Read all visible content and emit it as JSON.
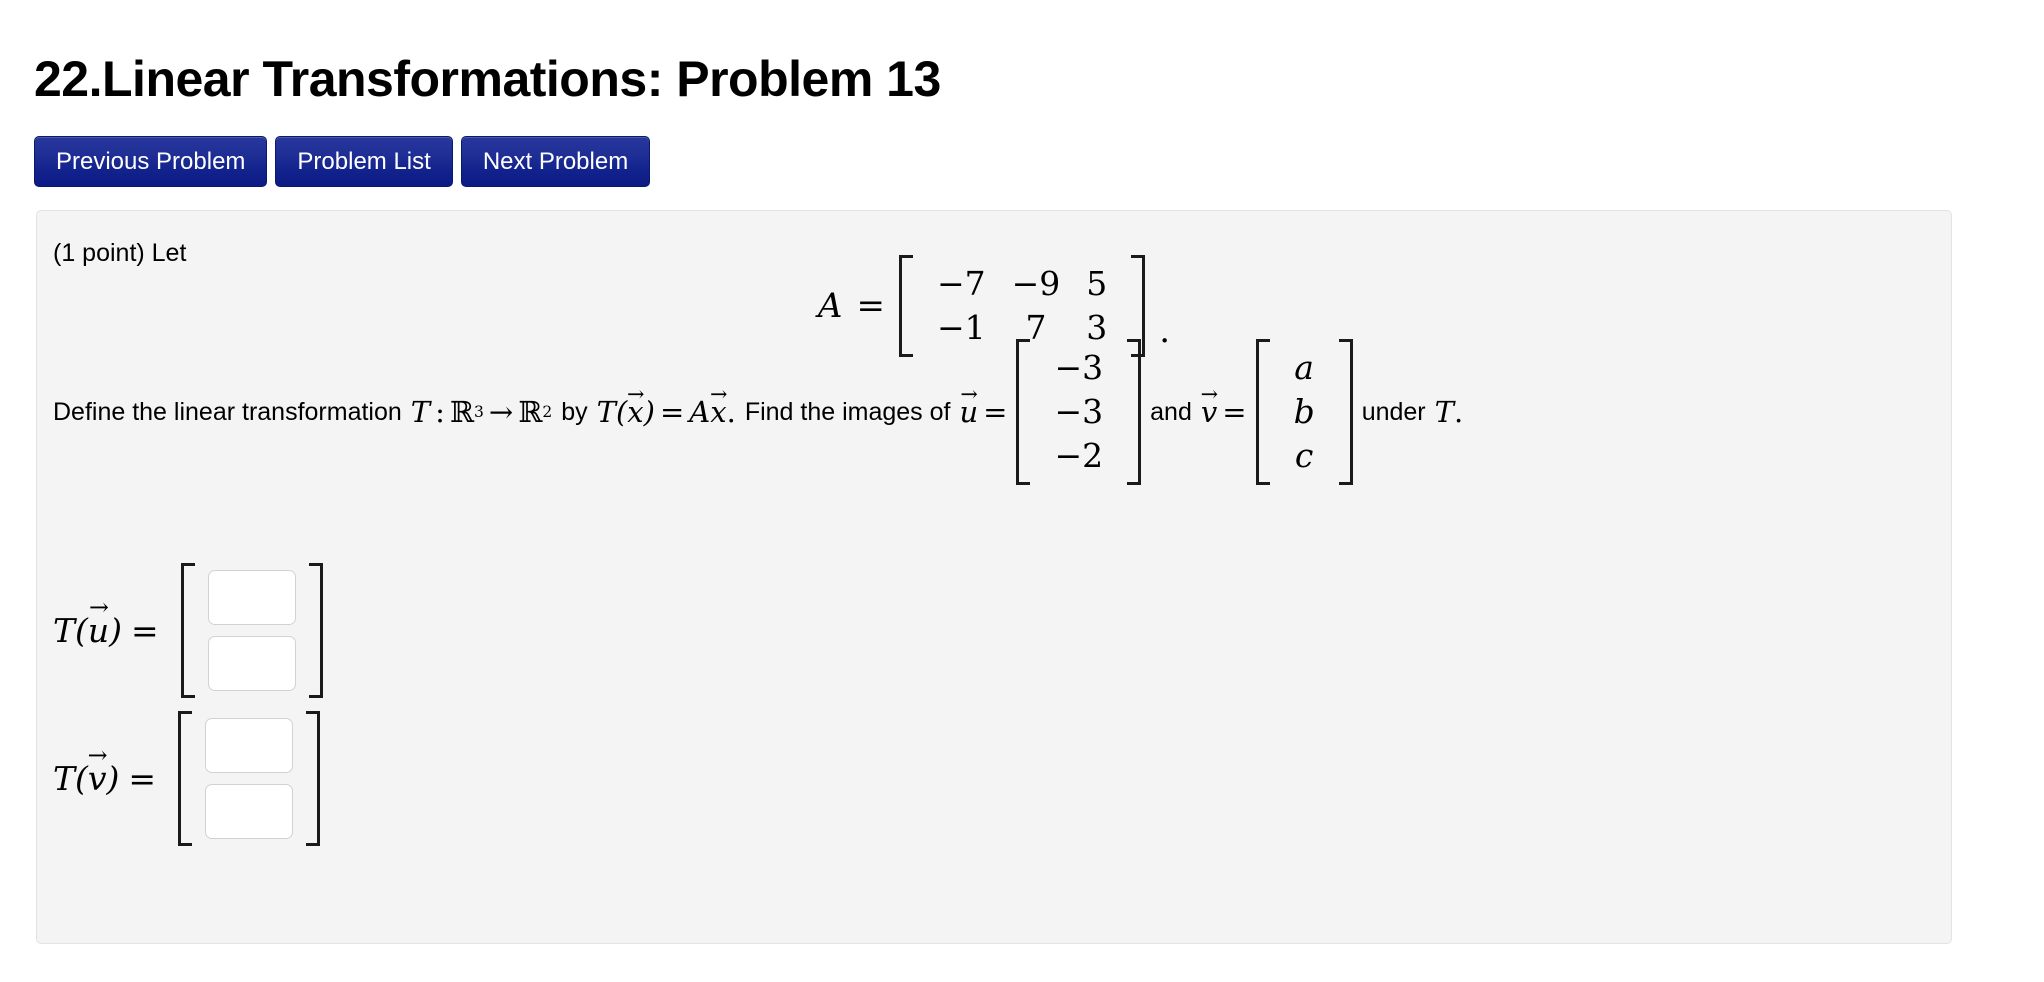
{
  "page": {
    "title": "22.Linear Transformations: Problem 13"
  },
  "nav": {
    "buttons": [
      {
        "label": "Previous Problem",
        "name": "previous-problem-button"
      },
      {
        "label": "Problem List",
        "name": "problem-list-button"
      },
      {
        "label": "Next Problem",
        "name": "next-problem-button"
      }
    ]
  },
  "problem": {
    "points_text": "(1 point) Let",
    "matrix_A": {
      "lhs_symbol": "A",
      "equals": "=",
      "rows": [
        [
          "−7",
          "−9",
          "5"
        ],
        [
          "−1",
          "7",
          "3"
        ]
      ],
      "trailing_punctuation": "."
    },
    "sentence": {
      "part1": "Define the linear transformation",
      "T": "T",
      "colon": ":",
      "domain_base": "ℝ",
      "domain_exp": "3",
      "arrow": "→",
      "codomain_base": "ℝ",
      "codomain_exp": "2",
      "by": "by",
      "T_of_x": "T(",
      "x_var": "x",
      "close_paren": ")",
      "eq": "=",
      "A_sym": "A",
      "x_var2": "x",
      "period1": ".",
      "part2": "Find the images of",
      "u_var": "u",
      "eq2": "=",
      "and": "and",
      "v_var": "v",
      "eq3": "=",
      "under": "under",
      "T2": "T",
      "period2": ".",
      "vec_arrow": "→"
    },
    "vector_u": {
      "entries": [
        "−3",
        "−3",
        "−2"
      ]
    },
    "vector_v": {
      "entries": [
        "a",
        "b",
        "c"
      ]
    },
    "answers": [
      {
        "name": "answer-row-Tu",
        "label_T": "T(",
        "label_var": "u",
        "label_close": ")",
        "label_eq": "=",
        "inputs": [
          {
            "name": "Tu-component-1-input",
            "value": "",
            "placeholder": ""
          },
          {
            "name": "Tu-component-2-input",
            "value": "",
            "placeholder": ""
          }
        ]
      },
      {
        "name": "answer-row-Tv",
        "label_T": "T(",
        "label_var": "v",
        "label_close": ")",
        "label_eq": "=",
        "inputs": [
          {
            "name": "Tv-component-1-input",
            "value": "",
            "placeholder": ""
          },
          {
            "name": "Tv-component-2-input",
            "value": "",
            "placeholder": ""
          }
        ]
      }
    ]
  },
  "colors": {
    "button_blue_top": "#27379c",
    "button_blue_bottom": "#0c1a84",
    "panel_background": "#f4f4f4",
    "panel_border": "#e3e3e3",
    "input_border": "#d2d2d2",
    "page_background": "#ffffff",
    "text": "#000000"
  }
}
